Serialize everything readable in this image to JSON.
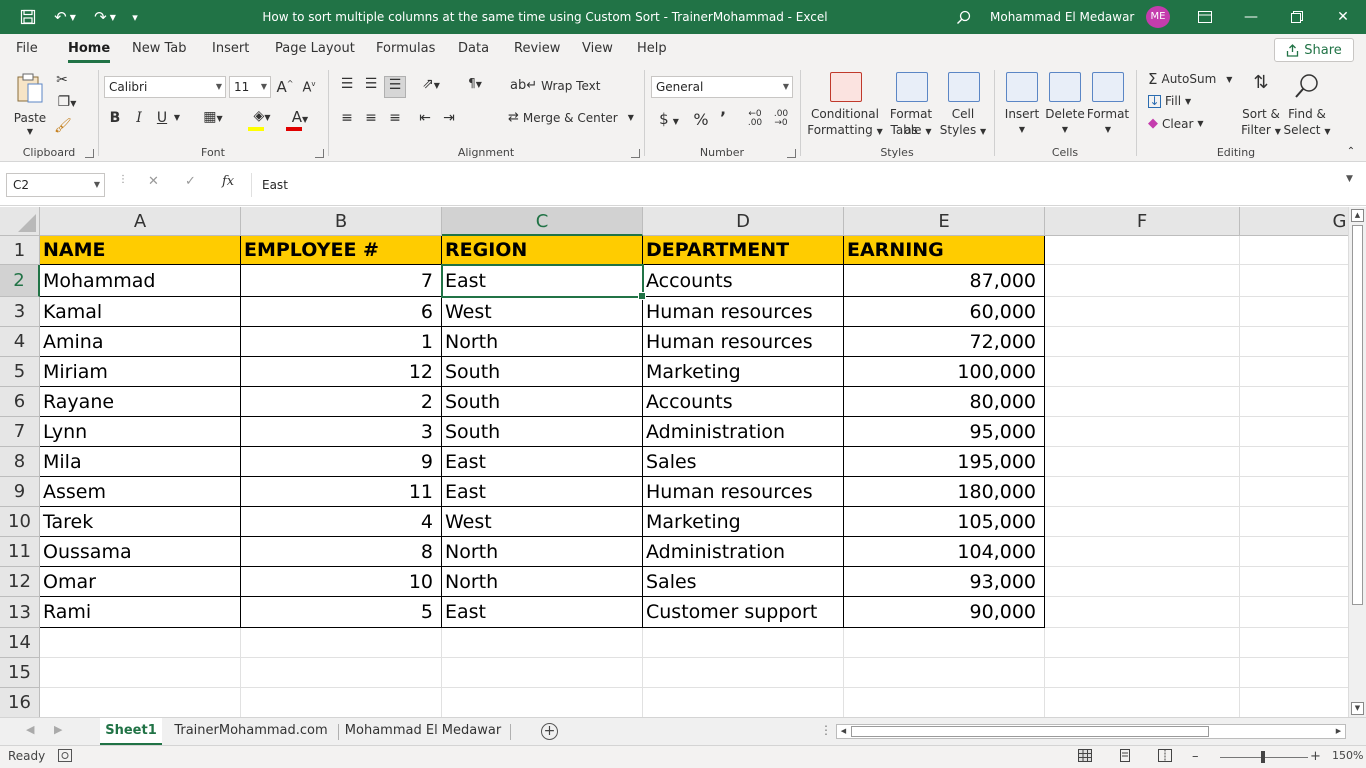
{
  "titlebar": {
    "title": "How to sort multiple columns at the same time using Custom Sort - TrainerMohammad  -  Excel",
    "user_name": "Mohammad El Medawar",
    "avatar_initials": "ME",
    "accent_color": "#217346"
  },
  "menu": {
    "tabs": [
      "File",
      "Home",
      "New Tab",
      "Insert",
      "Page Layout",
      "Formulas",
      "Data",
      "Review",
      "View",
      "Help"
    ],
    "active_tab": "Home",
    "share_label": "Share"
  },
  "ribbon": {
    "clipboard": {
      "paste_label": "Paste",
      "group_label": "Clipboard"
    },
    "font": {
      "font_name": "Calibri",
      "font_size": "11",
      "bold": "B",
      "italic": "I",
      "underline": "U",
      "group_label": "Font"
    },
    "alignment": {
      "wrap_text": "Wrap Text",
      "merge_center": "Merge & Center",
      "group_label": "Alignment"
    },
    "number": {
      "format": "General",
      "group_label": "Number"
    },
    "styles": {
      "conditional_formatting": "Conditional",
      "conditional_formatting_2": "Formatting",
      "format_as_table": "Format as",
      "format_as_table_2": "Table",
      "cell_styles": "Cell",
      "cell_styles_2": "Styles",
      "group_label": "Styles"
    },
    "cells": {
      "insert": "Insert",
      "delete": "Delete",
      "format": "Format",
      "group_label": "Cells"
    },
    "editing": {
      "autosum": "AutoSum",
      "fill": "Fill",
      "clear": "Clear",
      "sort_filter": "Sort &",
      "sort_filter_2": "Filter",
      "find_select": "Find &",
      "find_select_2": "Select",
      "group_label": "Editing"
    }
  },
  "formula_bar": {
    "name_box": "C2",
    "fx": "fx",
    "formula": "East"
  },
  "sheet": {
    "columns": [
      "A",
      "B",
      "C",
      "D",
      "E",
      "F",
      "G"
    ],
    "rows": [
      "1",
      "2",
      "3",
      "4",
      "5",
      "6",
      "7",
      "8",
      "9",
      "10",
      "11",
      "12",
      "13",
      "14",
      "15",
      "16"
    ],
    "header": [
      "NAME",
      "EMPLOYEE #",
      "REGION",
      "DEPARTMENT",
      "EARNING"
    ],
    "data": [
      [
        "Mohammad",
        "7",
        "East",
        "Accounts",
        "87,000"
      ],
      [
        "Kamal",
        "6",
        "West",
        "Human resources",
        "60,000"
      ],
      [
        "Amina",
        "1",
        "North",
        "Human resources",
        "72,000"
      ],
      [
        "Miriam",
        "12",
        "South",
        "Marketing",
        "100,000"
      ],
      [
        "Rayane",
        "2",
        "South",
        "Accounts",
        "80,000"
      ],
      [
        "Lynn",
        "3",
        "South",
        "Administration",
        "95,000"
      ],
      [
        "Mila",
        "9",
        "East",
        "Sales",
        "195,000"
      ],
      [
        "Assem",
        "11",
        "East",
        "Human resources",
        "180,000"
      ],
      [
        "Tarek",
        "4",
        "West",
        "Marketing",
        "105,000"
      ],
      [
        "Oussama",
        "8",
        "North",
        "Administration",
        "104,000"
      ],
      [
        "Omar",
        "10",
        "North",
        "Sales",
        "93,000"
      ],
      [
        "Rami",
        "5",
        "East",
        "Customer support",
        "90,000"
      ]
    ],
    "header_fill_color": "#ffcc00",
    "selected_cell": "C2"
  },
  "sheet_tabs": {
    "tabs": [
      "Sheet1",
      "TrainerMohammad.com",
      "Mohammad El Medawar"
    ],
    "active": "Sheet1"
  },
  "status": {
    "mode": "Ready",
    "zoom": "150%"
  }
}
